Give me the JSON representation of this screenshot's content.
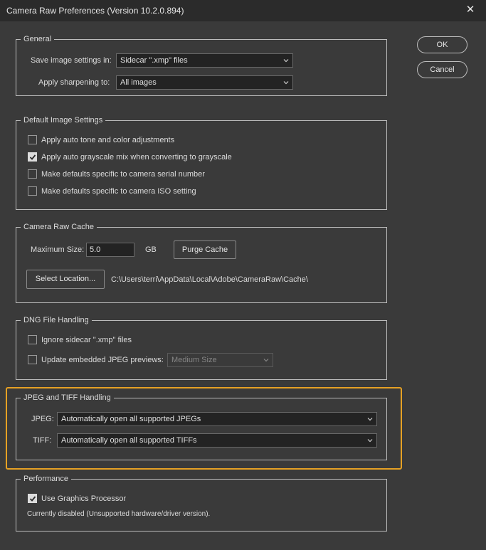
{
  "window": {
    "title": "Camera Raw Preferences  (Version 10.2.0.894)",
    "close_glyph": "✕"
  },
  "buttons": {
    "ok": "OK",
    "cancel": "Cancel"
  },
  "general": {
    "title": "General",
    "save_label": "Save image settings in:",
    "save_value": "Sidecar \".xmp\" files",
    "sharpen_label": "Apply sharpening to:",
    "sharpen_value": "All images"
  },
  "default_image": {
    "title": "Default Image Settings",
    "options": [
      {
        "label": "Apply auto tone and color adjustments",
        "checked": false
      },
      {
        "label": "Apply auto grayscale mix when converting to grayscale",
        "checked": true
      },
      {
        "label": "Make defaults specific to camera serial number",
        "checked": false
      },
      {
        "label": "Make defaults specific to camera ISO setting",
        "checked": false
      }
    ]
  },
  "cache": {
    "title": "Camera Raw Cache",
    "max_label": "Maximum Size:",
    "max_value": "5.0",
    "unit": "GB",
    "purge": "Purge Cache",
    "select_location": "Select Location...",
    "path": "C:\\Users\\terri\\AppData\\Local\\Adobe\\CameraRaw\\Cache\\"
  },
  "dng": {
    "title": "DNG File Handling",
    "ignore_label": "Ignore sidecar \".xmp\" files",
    "ignore_checked": false,
    "update_label": "Update embedded JPEG previews:",
    "update_checked": false,
    "preview_value": "Medium Size"
  },
  "jpeg_tiff": {
    "title": "JPEG and TIFF Handling",
    "jpeg_label": "JPEG:",
    "jpeg_value": "Automatically open all supported JPEGs",
    "tiff_label": "TIFF:",
    "tiff_value": "Automatically open all supported TIFFs"
  },
  "performance": {
    "title": "Performance",
    "gpu_label": "Use Graphics Processor",
    "gpu_checked": true,
    "status": "Currently disabled (Unsupported hardware/driver version)."
  },
  "colors": {
    "highlight": "#e6a124",
    "background": "#3a3a3a"
  }
}
